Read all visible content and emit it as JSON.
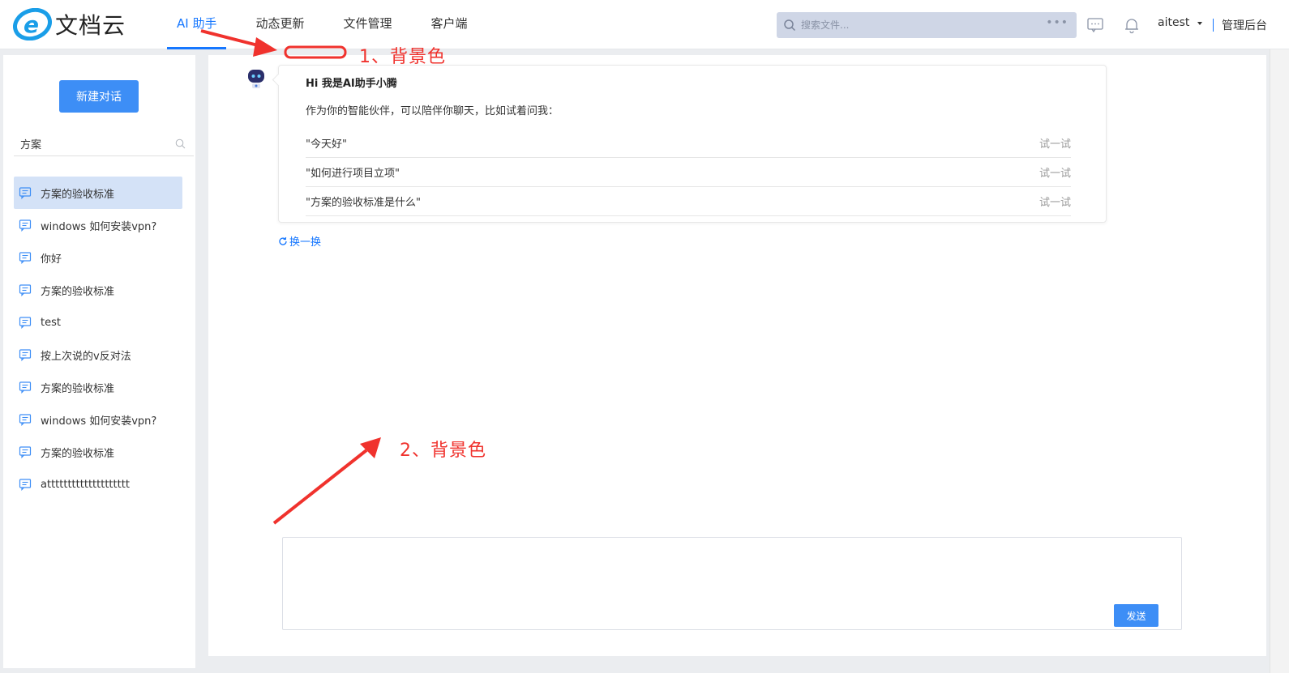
{
  "header": {
    "logo_text": "文档云",
    "nav": [
      {
        "label": "AI 助手",
        "active": true
      },
      {
        "label": "动态更新",
        "active": false
      },
      {
        "label": "文件管理",
        "active": false
      },
      {
        "label": "客户端",
        "active": false
      }
    ],
    "search_placeholder": "搜索文件...",
    "search_more": "•••",
    "user": "aitest",
    "admin_link": "管理后台",
    "accent_color": "#1677ff"
  },
  "sidebar": {
    "new_chat_label": "新建对话",
    "search_value": "方案",
    "conversations": [
      {
        "label": "方案的验收标准",
        "active": true
      },
      {
        "label": "windows 如何安装vpn?",
        "active": false
      },
      {
        "label": "你好",
        "active": false
      },
      {
        "label": "方案的验收标准",
        "active": false
      },
      {
        "label": "test",
        "active": false
      },
      {
        "label": "按上次说的v反对法",
        "active": false
      },
      {
        "label": "方案的验收标准",
        "active": false
      },
      {
        "label": "windows 如何安装vpn?",
        "active": false
      },
      {
        "label": "方案的验收标准",
        "active": false
      },
      {
        "label": "atttttttttttttttttttt",
        "active": false
      }
    ]
  },
  "main": {
    "greeting_title": "Hi 我是AI助手小腾",
    "greeting_sub": "作为你的智能伙伴，可以陪伴你聊天，比如试着问我：",
    "suggestions": [
      {
        "text": "\"今天好\"",
        "action": "试一试"
      },
      {
        "text": "\"如何进行项目立项\"",
        "action": "试一试"
      },
      {
        "text": "\"方案的验收标准是什么\"",
        "action": "试一试"
      }
    ],
    "refresh_label": "换一换",
    "send_label": "发送"
  },
  "annotations": {
    "note1": "1、背景色",
    "note2": "2、背景色",
    "color": "#f0322d"
  }
}
